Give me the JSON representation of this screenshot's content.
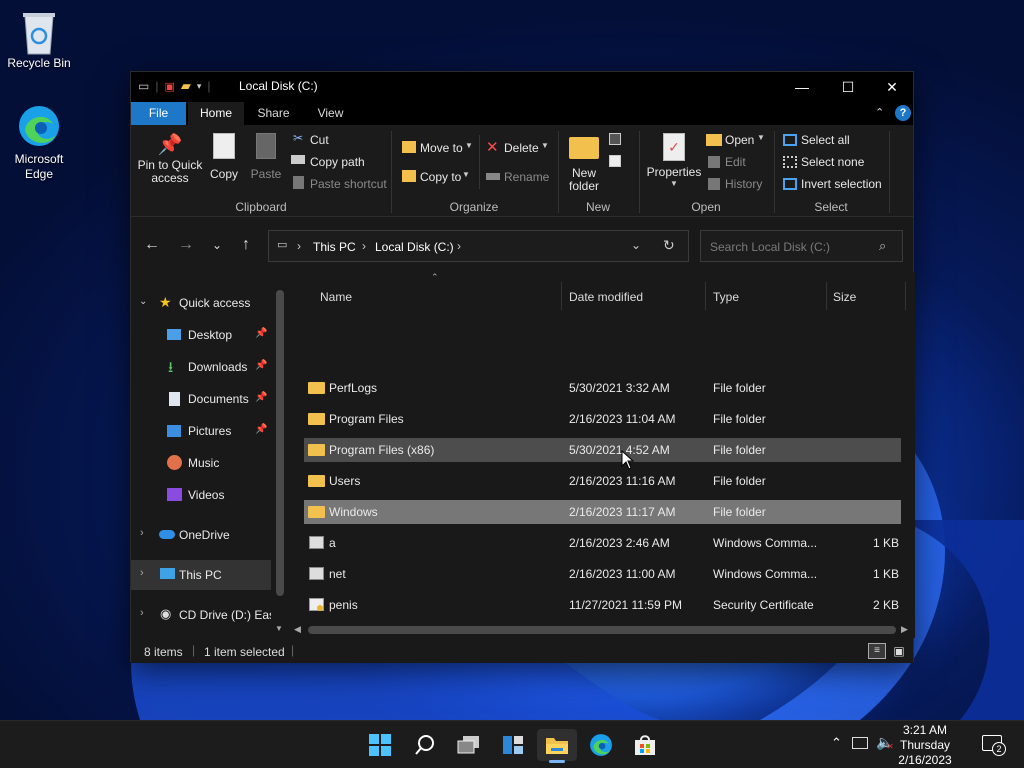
{
  "desktop": {
    "icons": [
      {
        "label": "Recycle Bin",
        "icon": "recycle-bin-icon"
      },
      {
        "label": "Microsoft Edge",
        "icon": "edge-icon"
      }
    ]
  },
  "window": {
    "title": "Local Disk (C:)",
    "tabs": {
      "file": "File",
      "home": "Home",
      "share": "Share",
      "view": "View"
    }
  },
  "ribbon": {
    "clipboard": {
      "pin": "Pin to Quick access",
      "copy": "Copy",
      "paste": "Paste",
      "cut": "Cut",
      "copy_path": "Copy path",
      "paste_shortcut": "Paste shortcut",
      "group": "Clipboard"
    },
    "organize": {
      "move_to": "Move to",
      "copy_to": "Copy to",
      "delete": "Delete",
      "rename": "Rename",
      "group": "Organize"
    },
    "new": {
      "new_folder": "New folder",
      "group": "New"
    },
    "open": {
      "properties": "Properties",
      "open": "Open",
      "edit": "Edit",
      "history": "History",
      "group": "Open"
    },
    "select": {
      "select_all": "Select all",
      "select_none": "Select none",
      "invert": "Invert selection",
      "group": "Select"
    }
  },
  "address": {
    "crumbs": [
      "This PC",
      "Local Disk (C:)"
    ],
    "search_placeholder": "Search Local Disk (C:)"
  },
  "sidebar": {
    "items": [
      {
        "label": "Quick access",
        "icon": "star-icon",
        "pinned": false
      },
      {
        "label": "Desktop",
        "icon": "desktop-icon",
        "pinned": true
      },
      {
        "label": "Downloads",
        "icon": "download-icon",
        "pinned": true
      },
      {
        "label": "Documents",
        "icon": "documents-icon",
        "pinned": true
      },
      {
        "label": "Pictures",
        "icon": "pictures-icon",
        "pinned": true
      },
      {
        "label": "Music",
        "icon": "music-icon",
        "pinned": false
      },
      {
        "label": "Videos",
        "icon": "videos-icon",
        "pinned": false
      },
      {
        "label": "OneDrive",
        "icon": "cloud-icon",
        "pinned": false
      },
      {
        "label": "This PC",
        "icon": "computer-icon",
        "pinned": false
      },
      {
        "label": "CD Drive (D:) Eas",
        "icon": "cd-drive-icon",
        "pinned": false
      }
    ]
  },
  "columns": {
    "name": "Name",
    "date": "Date modified",
    "type": "Type",
    "size": "Size"
  },
  "files": [
    {
      "name": "PerfLogs",
      "date": "5/30/2021 3:32 AM",
      "type": "File folder",
      "size": "",
      "icon": "folder-icon"
    },
    {
      "name": "Program Files",
      "date": "2/16/2023 11:04 AM",
      "type": "File folder",
      "size": "",
      "icon": "folder-icon"
    },
    {
      "name": "Program Files (x86)",
      "date": "5/30/2021 4:52 AM",
      "type": "File folder",
      "size": "",
      "icon": "folder-icon"
    },
    {
      "name": "Users",
      "date": "2/16/2023 11:16 AM",
      "type": "File folder",
      "size": "",
      "icon": "folder-icon"
    },
    {
      "name": "Windows",
      "date": "2/16/2023 11:17 AM",
      "type": "File folder",
      "size": "",
      "icon": "folder-icon"
    },
    {
      "name": "a",
      "date": "2/16/2023 2:46 AM",
      "type": "Windows Comma...",
      "size": "1 KB",
      "icon": "script-file-icon"
    },
    {
      "name": "net",
      "date": "2/16/2023 11:00 AM",
      "type": "Windows Comma...",
      "size": "1 KB",
      "icon": "script-file-icon"
    },
    {
      "name": "penis",
      "date": "11/27/2021 11:59 PM",
      "type": "Security Certificate",
      "size": "2 KB",
      "icon": "certificate-icon"
    }
  ],
  "status": {
    "items": "8 items",
    "selected": "1 item selected"
  },
  "taskbar": {
    "icons": [
      "windows-start-icon",
      "search-icon",
      "task-view-icon",
      "widgets-icon",
      "file-explorer-icon",
      "edge-icon",
      "store-icon"
    ],
    "time": "3:21 AM",
    "day": "Thursday",
    "date": "2/16/2023",
    "notifications": "2"
  },
  "colors": {
    "accent": "#1e78c8",
    "folder": "#f2c04c",
    "selected_row": "#777777",
    "hover_row": "#4d4d4d"
  }
}
